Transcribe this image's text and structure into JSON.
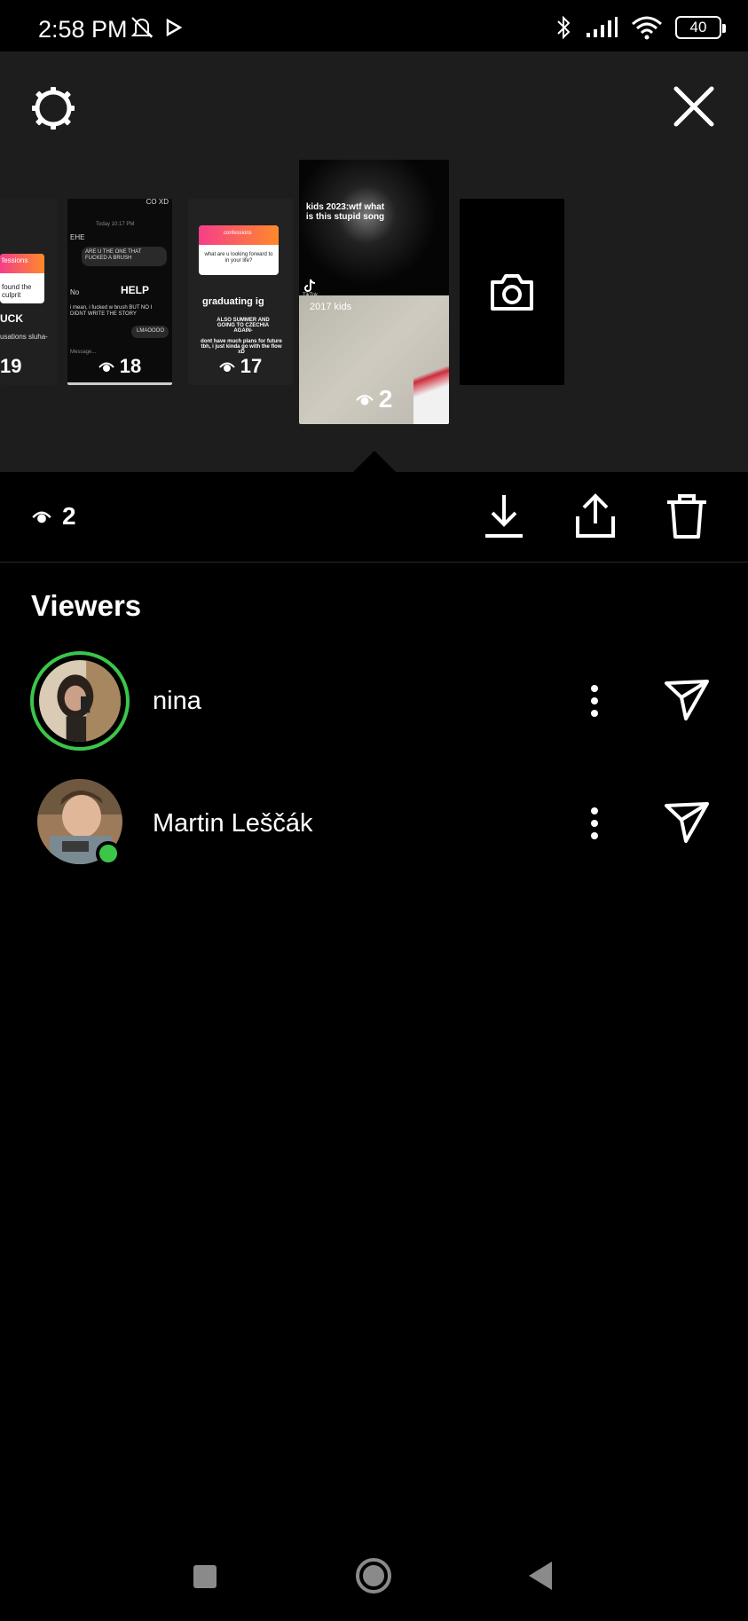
{
  "status_bar": {
    "time": "2:58 PM",
    "battery": "40",
    "icons": [
      "mute-bell-icon",
      "play-store-icon",
      "bluetooth-icon",
      "signal-icon",
      "wifi-icon",
      "battery-icon"
    ]
  },
  "header": {
    "settings_icon": "gear-icon",
    "close_icon": "close-icon"
  },
  "stories": [
    {
      "id": "story-1",
      "views": "19",
      "texts": [
        "fessions",
        "found the culprit",
        "UCK",
        "usations sluha-"
      ]
    },
    {
      "id": "story-2",
      "views": "18",
      "texts": [
        "CO XD",
        "Today 10:17 PM",
        "EHE",
        "ARE U THE ONE THAT FUCKED A BRUSH",
        "No",
        "HELP",
        "i mean, i fucked w brush BUT NO I DIDNT WRITE THE STORY",
        "LMAOOOO",
        "Message..."
      ]
    },
    {
      "id": "story-3",
      "views": "17",
      "texts": [
        "confessions",
        "what are u looking forward to in your life?",
        "graduating ig",
        "ALSO SUMMER AND GOING TO CZECHIA AGAIN-",
        "dont have much plans for future tbh, i just kinda go with the flow xD"
      ]
    },
    {
      "id": "story-4",
      "views": "2",
      "selected": true,
      "texts": [
        "kids 2023:wtf what is this stupid song",
        "TikTok",
        "2017 kids"
      ]
    },
    {
      "id": "add-story",
      "icon": "camera-icon"
    }
  ],
  "actions": {
    "view_count": "2",
    "download_icon": "download-icon",
    "share_icon": "share-icon",
    "delete_icon": "trash-icon"
  },
  "viewers": {
    "title": "Viewers",
    "list": [
      {
        "name": "nina",
        "has_story_ring": true,
        "online": false
      },
      {
        "name": "Martin Leščák",
        "has_story_ring": false,
        "online": true
      }
    ]
  },
  "colors": {
    "background": "#000000",
    "panel": "#1d1d1d",
    "online_green": "#3bc64a",
    "text": "#ffffff"
  }
}
